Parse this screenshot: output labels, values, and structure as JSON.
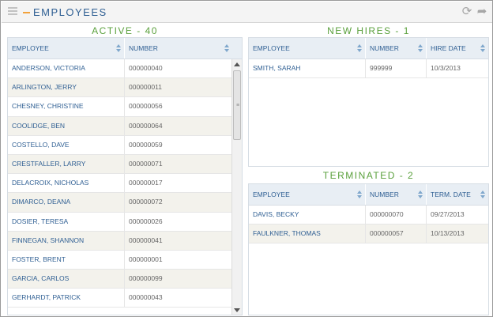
{
  "header": {
    "title": "EMPLOYEES"
  },
  "active": {
    "title": "ACTIVE - 40",
    "columns": [
      "EMPLOYEE",
      "NUMBER"
    ],
    "rows": [
      {
        "name": "ANDERSON, VICTORIA",
        "number": "000000040"
      },
      {
        "name": "ARLINGTON, JERRY",
        "number": "000000011"
      },
      {
        "name": "CHESNEY, CHRISTINE",
        "number": "000000056"
      },
      {
        "name": "COOLIDGE, BEN",
        "number": "000000064"
      },
      {
        "name": "COSTELLO, DAVE",
        "number": "000000059"
      },
      {
        "name": "CRESTFALLER, LARRY",
        "number": "000000071"
      },
      {
        "name": "DELACROIX, NICHOLAS",
        "number": "000000017"
      },
      {
        "name": "DIMARCO, DEANA",
        "number": "000000072"
      },
      {
        "name": "DOSIER, TERESA",
        "number": "000000026"
      },
      {
        "name": "FINNEGAN, SHANNON",
        "number": "000000041"
      },
      {
        "name": "FOSTER, BRENT",
        "number": "000000001"
      },
      {
        "name": "GARCIA, CARLOS",
        "number": "000000099"
      },
      {
        "name": "GERHARDT, PATRICK",
        "number": "000000043"
      }
    ]
  },
  "new_hires": {
    "title": "NEW HIRES - 1",
    "columns": [
      "EMPLOYEE",
      "NUMBER",
      "HIRE DATE"
    ],
    "rows": [
      {
        "name": "SMITH, SARAH",
        "number": "999999",
        "date": "10/3/2013"
      }
    ]
  },
  "terminated": {
    "title": "TERMINATED - 2",
    "columns": [
      "EMPLOYEE",
      "NUMBER",
      "TERM. DATE"
    ],
    "rows": [
      {
        "name": "DAVIS, BECKY",
        "number": "000000070",
        "date": "09/27/2013"
      },
      {
        "name": "FAULKNER, THOMAS",
        "number": "000000057",
        "date": "10/13/2013"
      }
    ]
  },
  "icons": {
    "refresh": "refresh-icon",
    "share": "share-arrow-icon",
    "menu": "grip-menu-icon"
  },
  "colors": {
    "accent_blue": "#2f5f93",
    "section_green": "#5aa03c",
    "header_orange": "#f2a23c",
    "row_alt": "#f3f2ec"
  }
}
